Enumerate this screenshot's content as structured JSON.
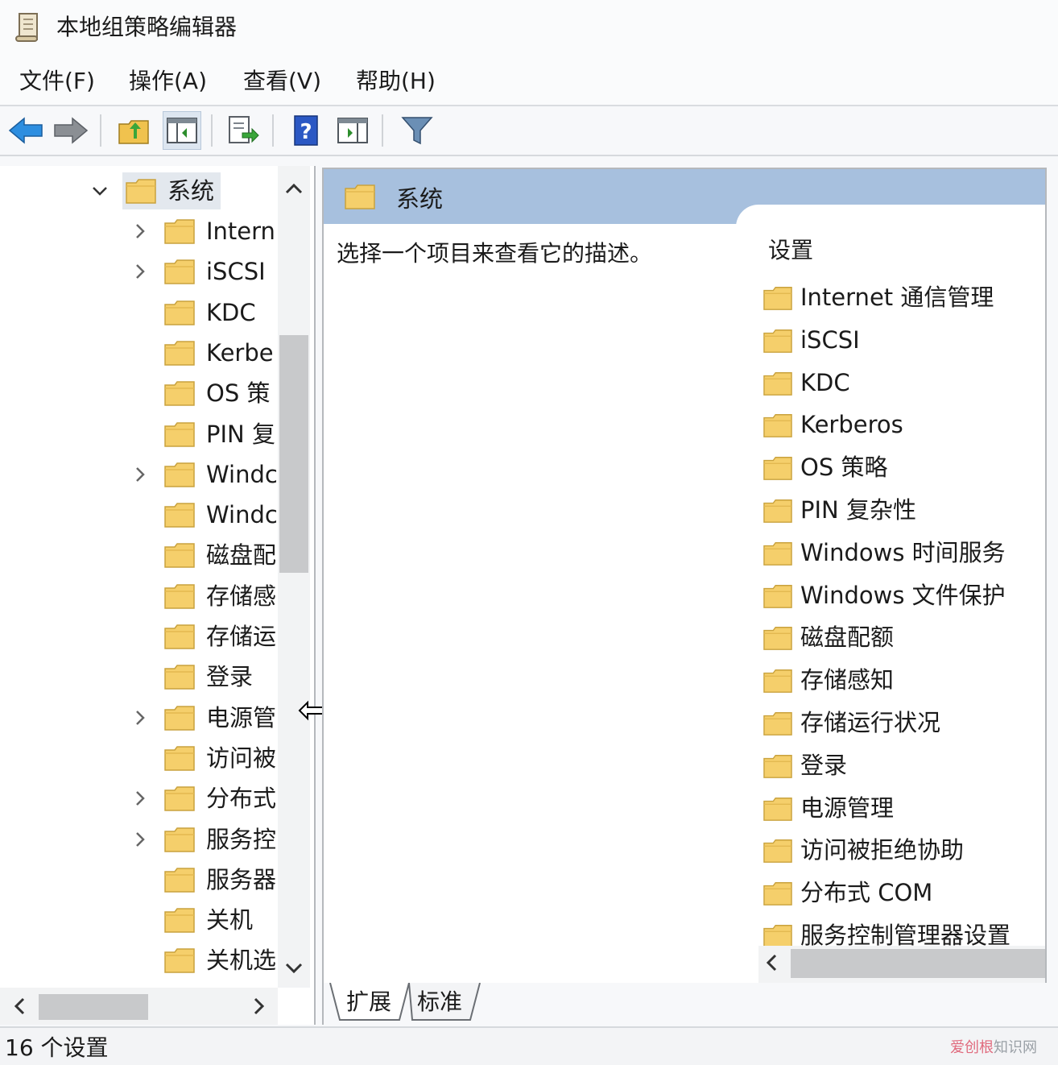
{
  "window": {
    "title": "本地组策略编辑器",
    "icon": "scroll-icon"
  },
  "menu": [
    "文件(F)",
    "操作(A)",
    "查看(V)",
    "帮助(H)"
  ],
  "toolbar": [
    "back-arrow-icon",
    "forward-arrow-icon",
    "up-folder-icon",
    "show-tree-icon",
    "export-list-icon",
    "help-icon",
    "show-action-pane-icon",
    "filter-icon"
  ],
  "tree": {
    "selected": "系统",
    "items": [
      {
        "label": "系统",
        "expand": "expanded"
      },
      {
        "label": "Intern",
        "expand": "collapsed"
      },
      {
        "label": "iSCSI",
        "expand": "collapsed"
      },
      {
        "label": "KDC",
        "expand": "none"
      },
      {
        "label": "Kerbe",
        "expand": "none"
      },
      {
        "label": "OS 策",
        "expand": "none"
      },
      {
        "label": "PIN 复",
        "expand": "none"
      },
      {
        "label": "Windc",
        "expand": "collapsed"
      },
      {
        "label": "Windc",
        "expand": "none"
      },
      {
        "label": "磁盘配",
        "expand": "none"
      },
      {
        "label": "存储感",
        "expand": "none"
      },
      {
        "label": "存储运",
        "expand": "none"
      },
      {
        "label": "登录",
        "expand": "none"
      },
      {
        "label": "电源管",
        "expand": "collapsed"
      },
      {
        "label": "访问被",
        "expand": "none"
      },
      {
        "label": "分布式",
        "expand": "collapsed"
      },
      {
        "label": "服务控",
        "expand": "collapsed"
      },
      {
        "label": "服务器",
        "expand": "none"
      },
      {
        "label": "关机",
        "expand": "none"
      },
      {
        "label": "关机选",
        "expand": "none"
      }
    ]
  },
  "right": {
    "header": "系统",
    "description": "选择一个项目来查看它的描述。",
    "column": "设置",
    "items": [
      "Internet 通信管理",
      "iSCSI",
      "KDC",
      "Kerberos",
      "OS 策略",
      "PIN 复杂性",
      "Windows 时间服务",
      "Windows 文件保护",
      "磁盘配额",
      "存储感知",
      "存储运行状况",
      "登录",
      "电源管理",
      "访问被拒绝协助",
      "分布式 COM",
      "服务控制管理器设置"
    ]
  },
  "tabs": [
    "扩展",
    "标准"
  ],
  "status": "16 个设置",
  "watermark": {
    "brand": "爱创根",
    "rest": "知识网"
  },
  "colors": {
    "header_band": "#a7c0de",
    "folder": "#f5cf6b",
    "selection": "#e3e8ee"
  }
}
